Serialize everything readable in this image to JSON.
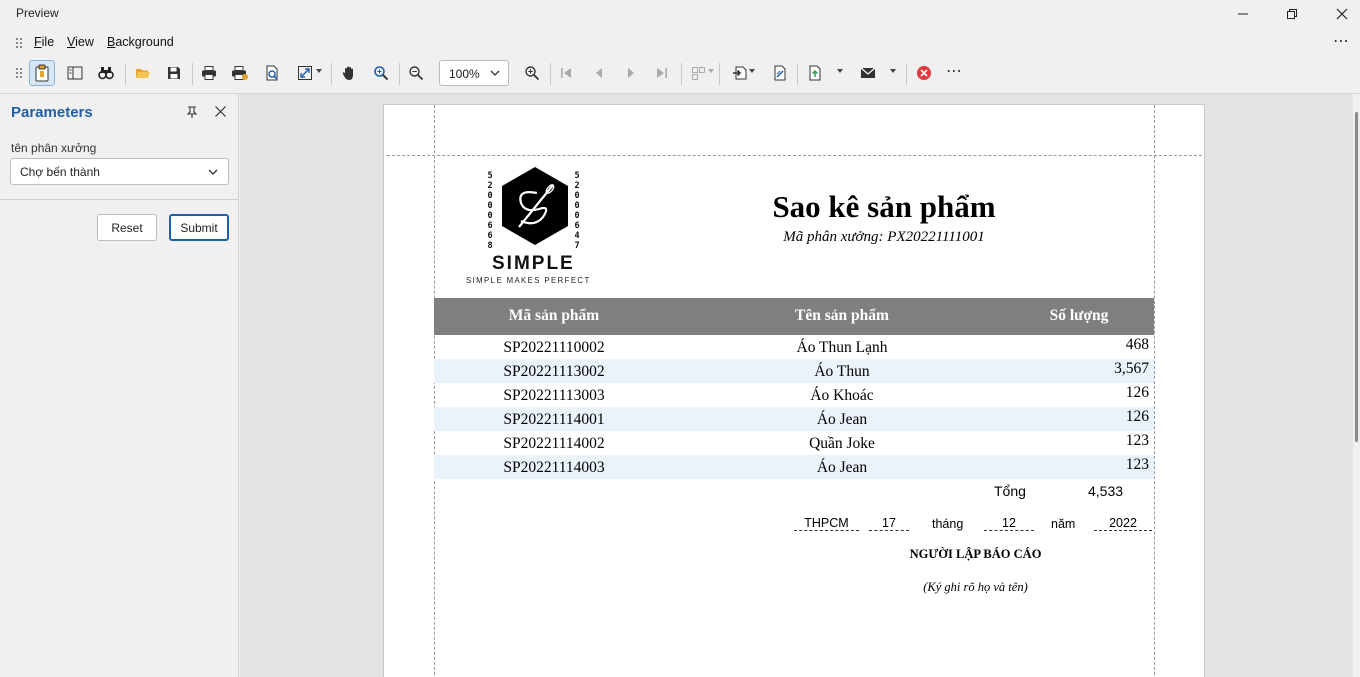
{
  "window": {
    "title": "Preview"
  },
  "menu": {
    "file_label": "File",
    "file_accel": "F",
    "file_rest": "ile",
    "view_label": "View",
    "view_accel": "V",
    "view_rest": "iew",
    "background_label": "Background",
    "background_accel": "B",
    "background_rest": "ackground"
  },
  "toolbar": {
    "zoom_value": "100%"
  },
  "parameters": {
    "title": "Parameters",
    "field_label": "tên phân xưởng",
    "field_value": "Chợ bến thành",
    "reset_label": "Reset",
    "submit_label": "Submit"
  },
  "report": {
    "logo_text": "SIMPLE",
    "logo_tagline": "SIMPLE MAKES PERFECT",
    "logo_left_digits": "52000668",
    "logo_right_digits": "52000647",
    "title": "Sao kê sản phẩm",
    "subtitle": "Mã phân xưởng: PX20221111001",
    "columns": [
      "Mã sản phẩm",
      "Tên sản phẩm",
      "Số lượng"
    ],
    "rows": [
      {
        "code": "SP20221110002",
        "name": "Áo Thun Lạnh",
        "qty": "468"
      },
      {
        "code": "SP20221113002",
        "name": "Áo Thun",
        "qty": "3,567"
      },
      {
        "code": "SP20221113003",
        "name": "Áo Khoác",
        "qty": "126"
      },
      {
        "code": "SP20221114001",
        "name": "Áo Jean",
        "qty": "126"
      },
      {
        "code": "SP20221114002",
        "name": "Quần Joke",
        "qty": "123"
      },
      {
        "code": "SP20221114003",
        "name": "Áo Jean",
        "qty": "123"
      }
    ],
    "total_label": "Tổng",
    "total_value": "4,533",
    "place": "THPCM",
    "day": "17",
    "month_word": "tháng",
    "month": "12",
    "year_word": "năm",
    "year": "2022",
    "signer_title": "NGƯỜI LẬP BÁO CÁO",
    "signer_note": "(Ký ghi rõ họ và tên)"
  },
  "colors": {
    "accent": "#1f5fa8",
    "table_header": "#7f7f7f",
    "row_alt": "#eaf3fb",
    "close_red": "#e0393e"
  }
}
